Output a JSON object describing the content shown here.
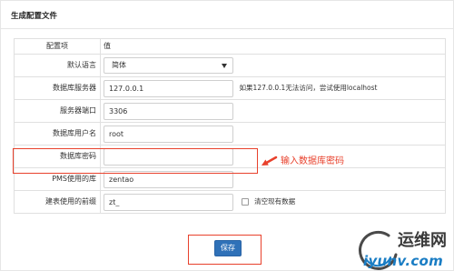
{
  "panel": {
    "title": "生成配置文件"
  },
  "table": {
    "header_item": "配置项",
    "header_value": "值",
    "rows": [
      {
        "label": "默认语言",
        "value": "简体"
      },
      {
        "label": "数据库服务器",
        "value": "127.0.0.1",
        "hint": "如果127.0.0.1无法访问，尝试使用localhost"
      },
      {
        "label": "服务器端口",
        "value": "3306"
      },
      {
        "label": "数据库用户名",
        "value": "root"
      },
      {
        "label": "数据库密码",
        "value": ""
      },
      {
        "label": "PMS使用的库",
        "value": "zentao"
      },
      {
        "label": "建表使用的前缀",
        "value": "zt_",
        "checkbox_label": "清空现有数据",
        "checkbox_checked": false
      }
    ]
  },
  "annotation": {
    "text": "输入数据库密码"
  },
  "actions": {
    "save_label": "保存"
  },
  "watermark": {
    "name": "运维网",
    "domain": "iyunv.com"
  },
  "icons": {
    "select_caret": "caret-down-icon",
    "annotation_arrow": "arrow-left-icon",
    "watermark_mark": "swoosh-icon"
  },
  "colors": {
    "accent": "#2f71b8",
    "annotation": "#e8412c",
    "border": "#e0e0e0",
    "watermark_blue": "#1a7dc4"
  }
}
